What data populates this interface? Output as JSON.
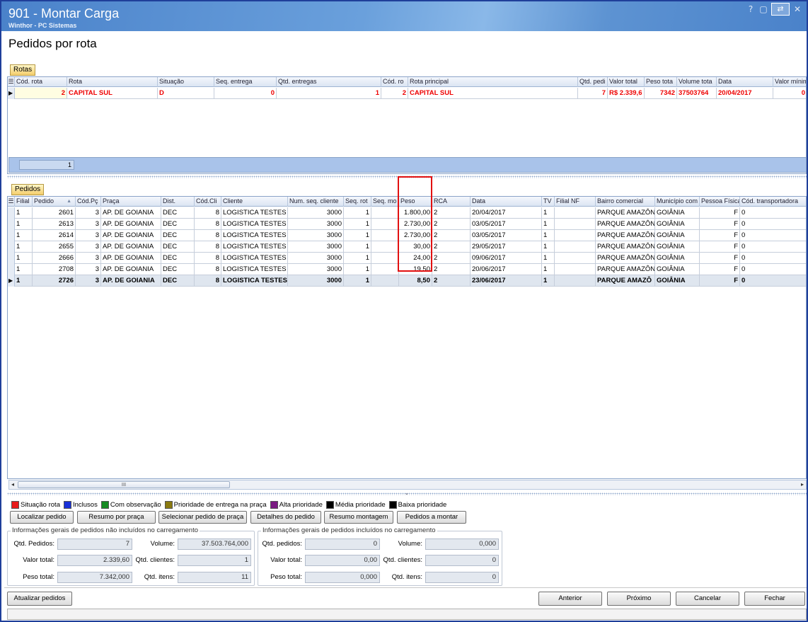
{
  "window": {
    "title": "901 - Montar Carga",
    "subtitle": "Winthor - PC Sistemas",
    "controls": [
      "?",
      "▢",
      "⇄",
      "✕"
    ]
  },
  "page_title": "Pedidos por rota",
  "rotas": {
    "tab": "Rotas",
    "headers": [
      "Cód. rota",
      "Rota",
      "Situação",
      "Seq. entrega",
      "Qtd. entregas",
      "Cód. ro",
      "Rota principal",
      "Qtd. pedi",
      "Valor total",
      "Peso tota",
      "Volume tota",
      "Data",
      "Valor mínim"
    ],
    "row": [
      "2",
      "CAPITAL SUL",
      "D",
      "0",
      "1",
      "2",
      "CAPITAL SUL",
      "7",
      "R$ 2.339,6",
      "7342",
      "37503764",
      "20/04/2017",
      "0"
    ],
    "footer_count": "1"
  },
  "pedidos": {
    "tab": "Pedidos",
    "headers": [
      "Filial",
      "Pedido",
      "Cód.Pç",
      "Praça",
      "Dist.",
      "Cód.Cli",
      "Cliente",
      "Num. seq. cliente",
      "Seq. rot",
      "Seq. mo",
      "Peso",
      "RCA",
      "Data",
      "TV",
      "Filial NF",
      "Bairro comercial",
      "Município com",
      "Pessoa Física",
      "Cód. transportadora"
    ],
    "rows": [
      [
        "1",
        "2601",
        "3",
        "AP. DE GOIANIA",
        "DEC",
        "8",
        "LOGISTICA TESTES",
        "3000",
        "1",
        "",
        "1.800,00",
        "2",
        "20/04/2017",
        "1",
        "",
        "PARQUE AMAZÔNI",
        "GOIÂNIA",
        "F",
        "0"
      ],
      [
        "1",
        "2613",
        "3",
        "AP. DE GOIANIA",
        "DEC",
        "8",
        "LOGISTICA TESTES",
        "3000",
        "1",
        "",
        "2.730,00",
        "2",
        "03/05/2017",
        "1",
        "",
        "PARQUE AMAZÔNI",
        "GOIÂNIA",
        "F",
        "0"
      ],
      [
        "1",
        "2614",
        "3",
        "AP. DE GOIANIA",
        "DEC",
        "8",
        "LOGISTICA TESTES",
        "3000",
        "1",
        "",
        "2.730,00",
        "2",
        "03/05/2017",
        "1",
        "",
        "PARQUE AMAZÔNI",
        "GOIÂNIA",
        "F",
        "0"
      ],
      [
        "1",
        "2655",
        "3",
        "AP. DE GOIANIA",
        "DEC",
        "8",
        "LOGISTICA TESTES",
        "3000",
        "1",
        "",
        "30,00",
        "2",
        "29/05/2017",
        "1",
        "",
        "PARQUE AMAZÔNI",
        "GOIÂNIA",
        "F",
        "0"
      ],
      [
        "1",
        "2666",
        "3",
        "AP. DE GOIANIA",
        "DEC",
        "8",
        "LOGISTICA TESTES",
        "3000",
        "1",
        "",
        "24,00",
        "2",
        "09/06/2017",
        "1",
        "",
        "PARQUE AMAZÔNI",
        "GOIÂNIA",
        "F",
        "0"
      ],
      [
        "1",
        "2708",
        "3",
        "AP. DE GOIANIA",
        "DEC",
        "8",
        "LOGISTICA TESTES",
        "3000",
        "1",
        "",
        "19,50",
        "2",
        "20/06/2017",
        "1",
        "",
        "PARQUE AMAZÔNI",
        "GOIÂNIA",
        "F",
        "0"
      ],
      [
        "1",
        "2726",
        "3",
        "AP. DE GOIANIA",
        "DEC",
        "8",
        "LOGISTICA TESTES",
        "3000",
        "1",
        "",
        "8,50",
        "2",
        "23/06/2017",
        "1",
        "",
        "PARQUE AMAZÔ",
        "GOIÂNIA",
        "F",
        "0"
      ]
    ]
  },
  "legend": [
    {
      "label": "Situação rota",
      "color": "#e81c1c"
    },
    {
      "label": "Inclusos",
      "color": "#1830d8"
    },
    {
      "label": "Com observação",
      "color": "#168a22"
    },
    {
      "label": "Prioridade de entrega na praça",
      "color": "#8a7a10"
    },
    {
      "label": "Alta prioridade",
      "color": "#7a1a82"
    },
    {
      "label": "Média prioridade",
      "color": "#000000"
    },
    {
      "label": "Baixa prioridade",
      "color": "#000000"
    }
  ],
  "actions": [
    "Localizar pedido",
    "Resumo por praça",
    "Selecionar pedido de praça",
    "Detalhes do pedido",
    "Resumo montagem",
    "Pedidos a montar"
  ],
  "nao_incluidos": {
    "title": "Informações gerais de pedidos não incluídos no carregamento",
    "qtd_pedidos_label": "Qtd. Pedidos:",
    "qtd_pedidos": "7",
    "volume_label": "Volume:",
    "volume": "37.503.764,000",
    "valor_total_label": "Valor total:",
    "valor_total": "2.339,60",
    "qtd_clientes_label": "Qtd. clientes:",
    "qtd_clientes": "1",
    "peso_total_label": "Peso total:",
    "peso_total": "7.342,000",
    "qtd_itens_label": "Qtd. itens:",
    "qtd_itens": "11"
  },
  "incluidos": {
    "title": "Informações gerais de pedidos incluídos no carregamento",
    "qtd_pedidos_label": "Qtd. pedidos:",
    "qtd_pedidos": "0",
    "volume_label": "Volume:",
    "volume": "0,000",
    "valor_total_label": "Valor total:",
    "valor_total": "0,00",
    "qtd_clientes_label": "Qtd. clientes:",
    "qtd_clientes": "0",
    "peso_total_label": "Peso total:",
    "peso_total": "0,000",
    "qtd_itens_label": "Qtd. itens:",
    "qtd_itens": "0"
  },
  "bottom": {
    "atualizar": "Atualizar pedidos",
    "anterior": "Anterior",
    "proximo": "Próximo",
    "cancelar": "Cancelar",
    "fechar": "Fechar"
  },
  "scrollbar_grip": "III",
  "colors": {
    "highlight": "#e21010",
    "route_text": "#e00000"
  }
}
